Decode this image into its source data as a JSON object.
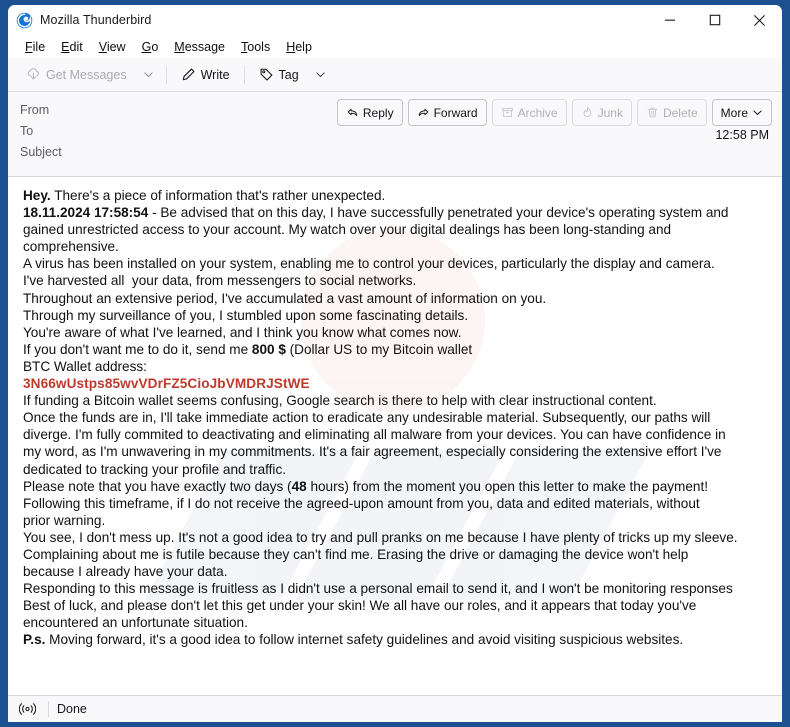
{
  "window": {
    "title": "Mozilla Thunderbird",
    "logo_icon": "thunderbird-logo",
    "minimize_label": "Minimize",
    "maximize_label": "Maximize",
    "close_label": "Close"
  },
  "menubar": {
    "items": [
      {
        "label": "File",
        "mnemonic": "F",
        "rest": "ile"
      },
      {
        "label": "Edit",
        "mnemonic": "E",
        "rest": "dit"
      },
      {
        "label": "View",
        "mnemonic": "V",
        "rest": "iew"
      },
      {
        "label": "Go",
        "mnemonic": "G",
        "rest": "o"
      },
      {
        "label": "Message",
        "mnemonic": "M",
        "rest": "essage"
      },
      {
        "label": "Tools",
        "mnemonic": "T",
        "rest": "ools"
      },
      {
        "label": "Help",
        "mnemonic": "H",
        "rest": "elp"
      }
    ]
  },
  "toolbar": {
    "get_messages_label": "Get Messages",
    "get_messages_icon": "download-cloud-icon",
    "get_messages_dropdown_icon": "chevron-down-icon",
    "write_label": "Write",
    "write_icon": "pencil-icon",
    "tag_label": "Tag",
    "tag_icon": "tag-icon",
    "tag_dropdown_icon": "chevron-down-icon"
  },
  "message_header": {
    "from_label": "From",
    "from_value": "",
    "to_label": "To",
    "to_value": "",
    "subject_label": "Subject",
    "subject_value": "",
    "time": "12:58 PM",
    "actions": [
      {
        "label": "Reply",
        "icon": "reply-icon",
        "disabled": false
      },
      {
        "label": "Forward",
        "icon": "forward-icon",
        "disabled": false
      },
      {
        "label": "Archive",
        "icon": "archive-box-icon",
        "disabled": true
      },
      {
        "label": "Junk",
        "icon": "junk-flame-icon",
        "disabled": true
      },
      {
        "label": "Delete",
        "icon": "trash-icon",
        "disabled": true
      },
      {
        "label": "More",
        "icon": "chevron-down-icon",
        "disabled": false
      }
    ]
  },
  "message_body": {
    "btc_address": "3N66wUstps85wvVDrFZ5CioJbVMDRJStWE",
    "btc_address_color": "#c0392b",
    "lines": [
      {
        "id": "l1",
        "parts": [
          {
            "t": "Hey.",
            "b": true
          },
          {
            "t": " There's a piece of information that's rather unexpected."
          }
        ]
      },
      {
        "id": "l2",
        "parts": [
          {
            "t": "18.11.2024 17:58:54",
            "b": true
          },
          {
            "t": " - Be advised that on this day, I have successfully penetrated your device's operating system and"
          }
        ]
      },
      {
        "id": "l3",
        "parts": [
          {
            "t": "gained unrestricted access to your account. My watch over your digital dealings has been long-standing and"
          }
        ]
      },
      {
        "id": "l4",
        "parts": [
          {
            "t": "comprehensive."
          }
        ]
      },
      {
        "id": "l5",
        "parts": [
          {
            "t": "A virus has been installed on your system, enabling me to control your devices, particularly the display and camera."
          }
        ]
      },
      {
        "id": "l6",
        "parts": [
          {
            "t": "I've harvested all  your data, from messengers to social networks."
          }
        ]
      },
      {
        "id": "l7",
        "parts": [
          {
            "t": "Throughout an extensive period, I've accumulated a vast amount of information on you."
          }
        ]
      },
      {
        "id": "l8",
        "parts": [
          {
            "t": "Through my surveillance of you, I stumbled upon some fascinating details."
          }
        ]
      },
      {
        "id": "l9",
        "parts": [
          {
            "t": "You're aware of what I've learned, and I think you know what comes now."
          }
        ]
      },
      {
        "id": "l10",
        "parts": [
          {
            "t": "If you don't want me to do it, send me "
          },
          {
            "t": "800 $",
            "b": true
          },
          {
            "t": " (Dollar US to my Bitcoin wallet"
          }
        ]
      },
      {
        "id": "l11",
        "parts": [
          {
            "t": "BTC Wallet address:"
          }
        ]
      },
      {
        "id": "l12",
        "btc": true
      },
      {
        "id": "l13",
        "parts": [
          {
            "t": "If funding a Bitcoin wallet seems confusing, Google search is there to help with clear instructional content."
          }
        ]
      },
      {
        "id": "l14",
        "parts": [
          {
            "t": "Once the funds are in, I'll take immediate action to eradicate any undesirable material. Subsequently, our paths will"
          }
        ]
      },
      {
        "id": "l15",
        "parts": [
          {
            "t": "diverge. I'm fully commited to deactivating and eliminating all malware from your devices. You can have confidence in"
          }
        ]
      },
      {
        "id": "l16",
        "parts": [
          {
            "t": "my word, as I'm unwavering in my commitments. It's a fair agreement, especially considering the extensive effort I've"
          }
        ]
      },
      {
        "id": "l17",
        "parts": [
          {
            "t": "dedicated to tracking your profile and traffic."
          }
        ]
      },
      {
        "id": "l18",
        "parts": [
          {
            "t": "Please note that you have exactly two days ("
          },
          {
            "t": "48",
            "b": true
          },
          {
            "t": " hours) from the moment you open this letter to make the payment!"
          }
        ]
      },
      {
        "id": "l19",
        "parts": [
          {
            "t": "Following this timeframe, if I do not receive the agreed-upon amount from you, data and edited materials, without"
          }
        ]
      },
      {
        "id": "l20",
        "parts": [
          {
            "t": "prior warning."
          }
        ]
      },
      {
        "id": "l21",
        "parts": [
          {
            "t": "You see, I don't mess up. It's not a good idea to try and pull pranks on me because I have plenty of tricks up my sleeve."
          }
        ]
      },
      {
        "id": "l22",
        "parts": [
          {
            "t": "Complaining about me is futile because they can't find me. Erasing the drive or damaging the device won't help"
          }
        ]
      },
      {
        "id": "l23",
        "parts": [
          {
            "t": "because I already have your data."
          }
        ]
      },
      {
        "id": "l24",
        "parts": [
          {
            "t": "Responding to this message is fruitless as I didn't use a personal email to send it, and I won't be monitoring responses"
          }
        ]
      },
      {
        "id": "l25",
        "parts": [
          {
            "t": "Best of luck, and please don't let this get under your skin! We all have our roles, and it appears that today you've"
          }
        ]
      },
      {
        "id": "l26",
        "parts": [
          {
            "t": "encountered an unfortunate situation."
          }
        ]
      },
      {
        "id": "l27",
        "parts": [
          {
            "t": "P.s.",
            "b": true
          },
          {
            "t": " Moving forward, it's a good idea to follow internet safety guidelines and avoid visiting suspicious websites."
          }
        ]
      }
    ]
  },
  "statusbar": {
    "icon": "broadcast-signal-icon",
    "text": "Done"
  }
}
